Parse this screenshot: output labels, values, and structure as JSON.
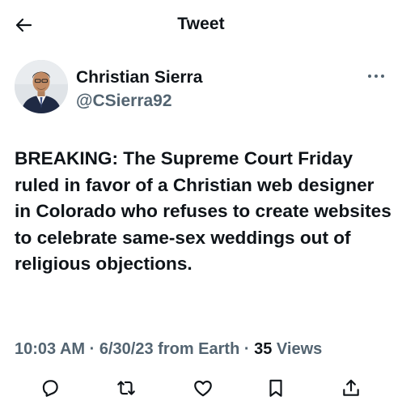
{
  "header": {
    "title": "Tweet",
    "back_icon": "arrow-left-icon"
  },
  "author": {
    "display_name": "Christian Sierra",
    "handle": "@CSierra92",
    "more_icon": "more-horizontal-icon"
  },
  "tweet": {
    "text": "BREAKING: The Supreme Court Friday ruled in favor of a Christian web designer in Colorado who refuses to create websites to celebrate same-sex weddings out of religious objections.",
    "time": "10:03 AM",
    "date": "6/30/23",
    "source": "from Earth",
    "separator": "·",
    "views_count": "35",
    "views_label": "Views"
  },
  "actions": [
    "reply-icon",
    "retweet-icon",
    "like-icon",
    "bookmark-icon",
    "share-icon"
  ],
  "colors": {
    "text": "#0f1419",
    "secondary": "#536471"
  }
}
